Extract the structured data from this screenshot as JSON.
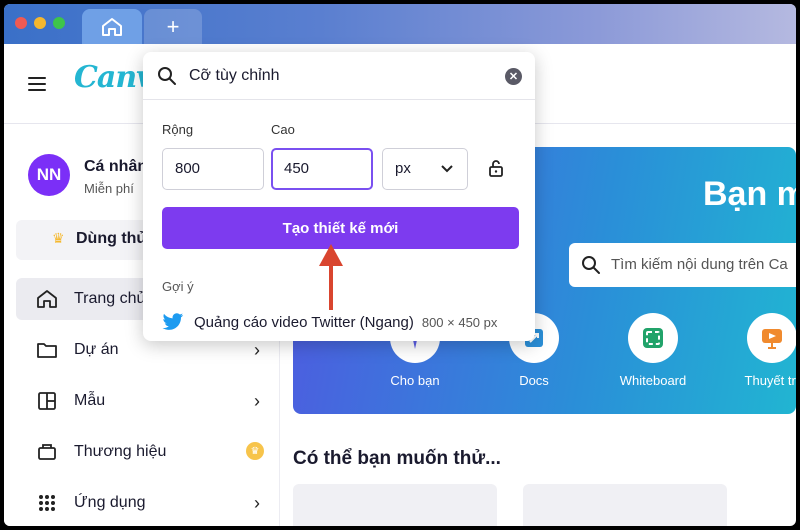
{
  "tabs": {
    "home_icon": "home-icon",
    "new_tab_label": "+"
  },
  "header": {
    "logo": "Canva",
    "menu_icon": "hamburger-icon"
  },
  "account": {
    "initials": "NN",
    "name": "Cá nhân",
    "plan": "Miễn phí"
  },
  "trial": {
    "label": "Dùng thử",
    "icon": "crown-icon"
  },
  "sidebar": {
    "items": [
      {
        "label": "Trang chủ",
        "icon": "home-icon",
        "active": true
      },
      {
        "label": "Dự án",
        "icon": "folder-icon"
      },
      {
        "label": "Mẫu",
        "icon": "template-icon"
      },
      {
        "label": "Thương hiệu",
        "icon": "brand-icon"
      },
      {
        "label": "Ứng dụng",
        "icon": "apps-icon"
      }
    ]
  },
  "popup": {
    "search_value": "Cỡ tùy chỉnh",
    "width_label": "Rộng",
    "height_label": "Cao",
    "width_value": "800",
    "height_value": "450",
    "unit": "px",
    "create_button": "Tạo thiết kế mới",
    "suggestions_title": "Gợi ý",
    "suggestion": {
      "label": "Quảng cáo video Twitter (Ngang)",
      "size": "800 × 450 px",
      "icon": "twitter-icon"
    }
  },
  "hero": {
    "title": "Bạn m",
    "search_placeholder": "Tìm kiếm nội dung trên Ca",
    "categories": [
      {
        "label": "Cho bạn",
        "icon": "sparkle-icon"
      },
      {
        "label": "Docs",
        "icon": "docs-icon"
      },
      {
        "label": "Whiteboard",
        "icon": "whiteboard-icon"
      },
      {
        "label": "Thuyết trì",
        "icon": "presentation-icon"
      }
    ]
  },
  "section": {
    "title": "Có thể bạn muốn thử..."
  },
  "colors": {
    "accent": "#7d3bef",
    "annotation_arrow": "#d9452f",
    "avatar": "#7b2ff7"
  }
}
